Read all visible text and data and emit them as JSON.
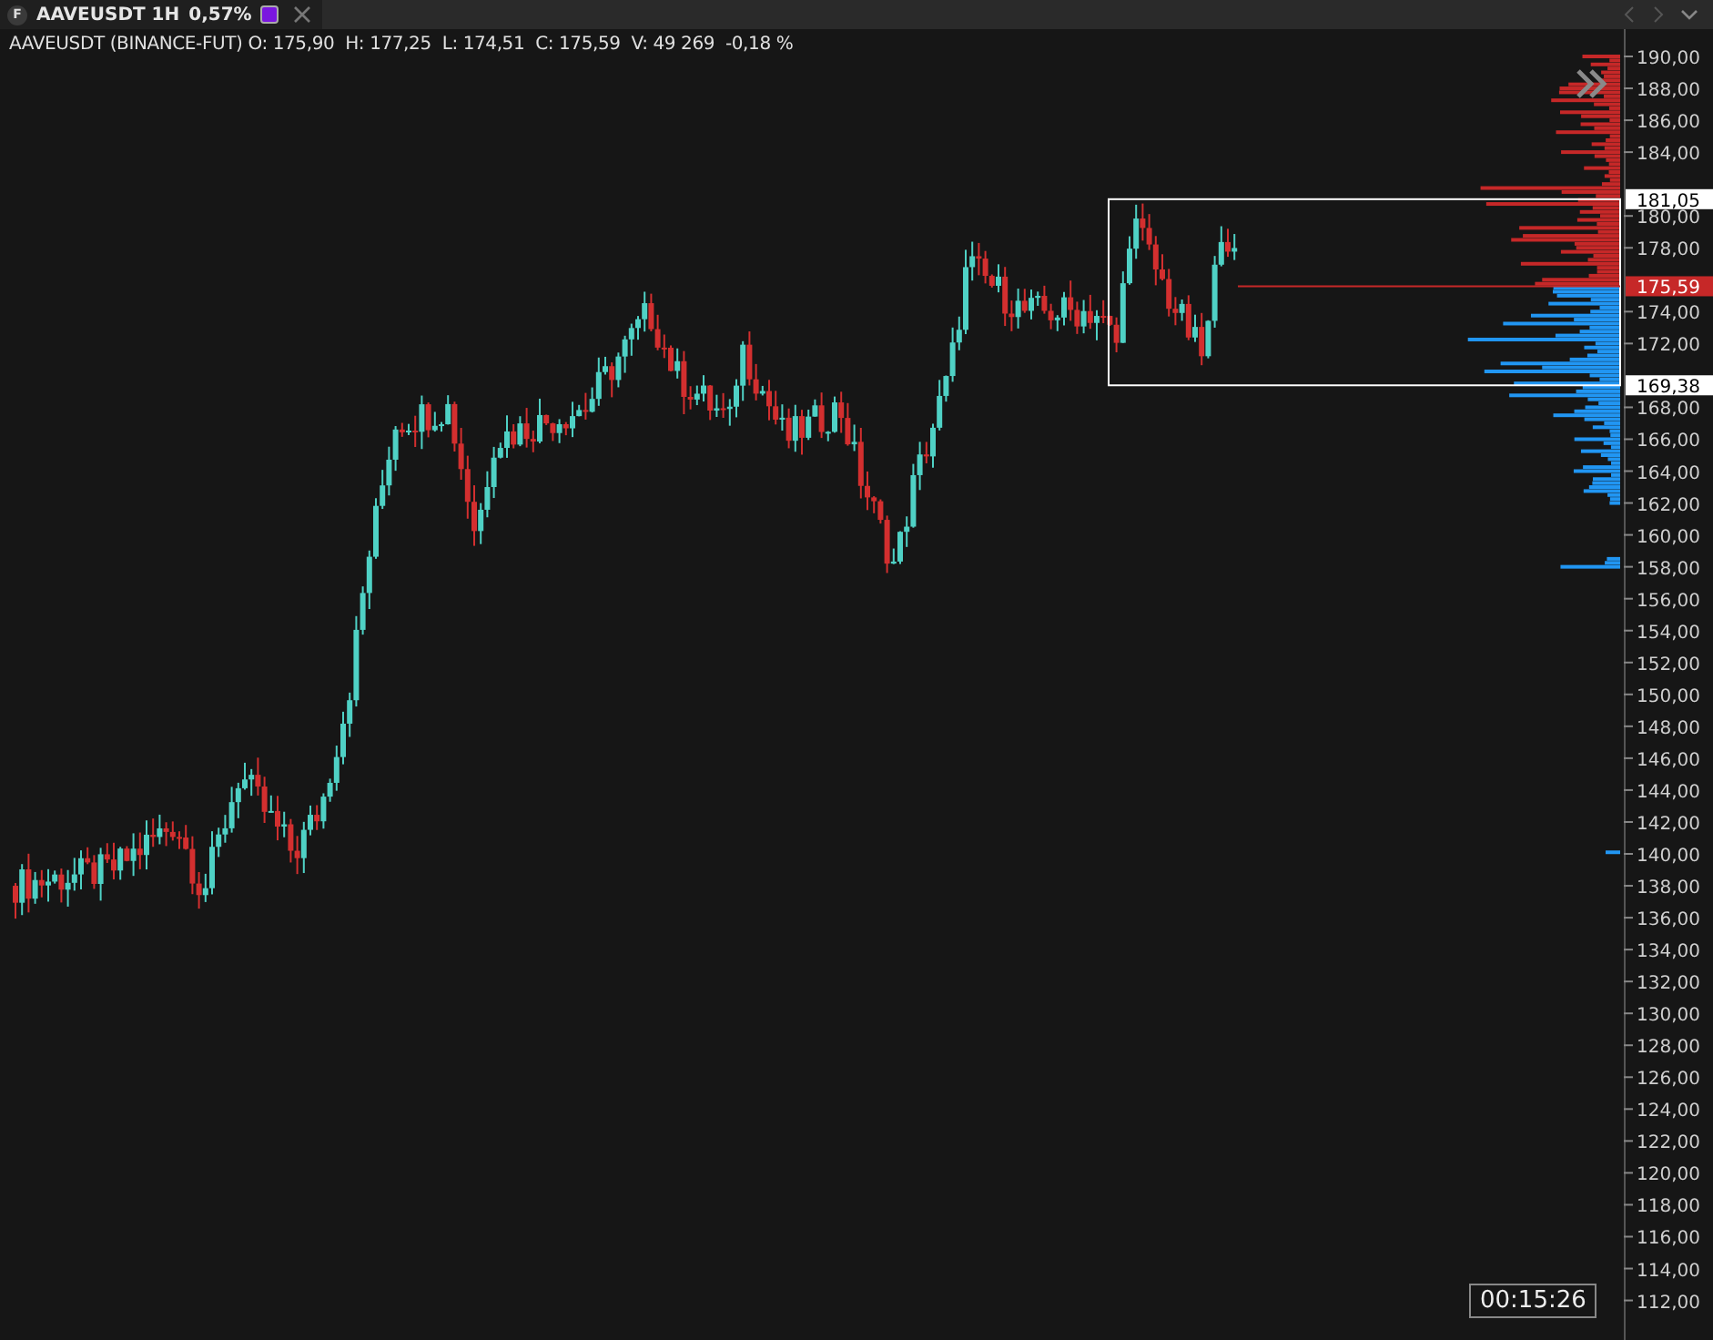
{
  "tab": {
    "badge": "F",
    "title": "AAVEUSDT 1H",
    "change": "0,57%",
    "color": "#7a16e0"
  },
  "legend": "AAVEUSDT (BINANCE-FUT) O: 175,90  H: 177,25  L: 174,51  C: 175,59  V: 49 269  -0,18 %",
  "price_axis": [
    "190,00",
    "188,00",
    "186,00",
    "184,00",
    "180,00",
    "178,00",
    "174,00",
    "172,00",
    "168,00",
    "166,00",
    "164,00",
    "162,00",
    "160,00",
    "158,00",
    "156,00",
    "154,00",
    "152,00",
    "150,00",
    "148,00",
    "146,00",
    "144,00",
    "142,00",
    "140,00",
    "138,00",
    "136,00",
    "134,00",
    "132,00",
    "130,00",
    "128,00",
    "126,00",
    "124,00",
    "122,00",
    "120,00",
    "118,00",
    "116,00",
    "114,00",
    "112,00"
  ],
  "price_markers": [
    {
      "value": "181,05",
      "kind": "level"
    },
    {
      "value": "175,59",
      "kind": "last"
    },
    {
      "value": "169,38",
      "kind": "level"
    }
  ],
  "timer": "00:15:26"
}
